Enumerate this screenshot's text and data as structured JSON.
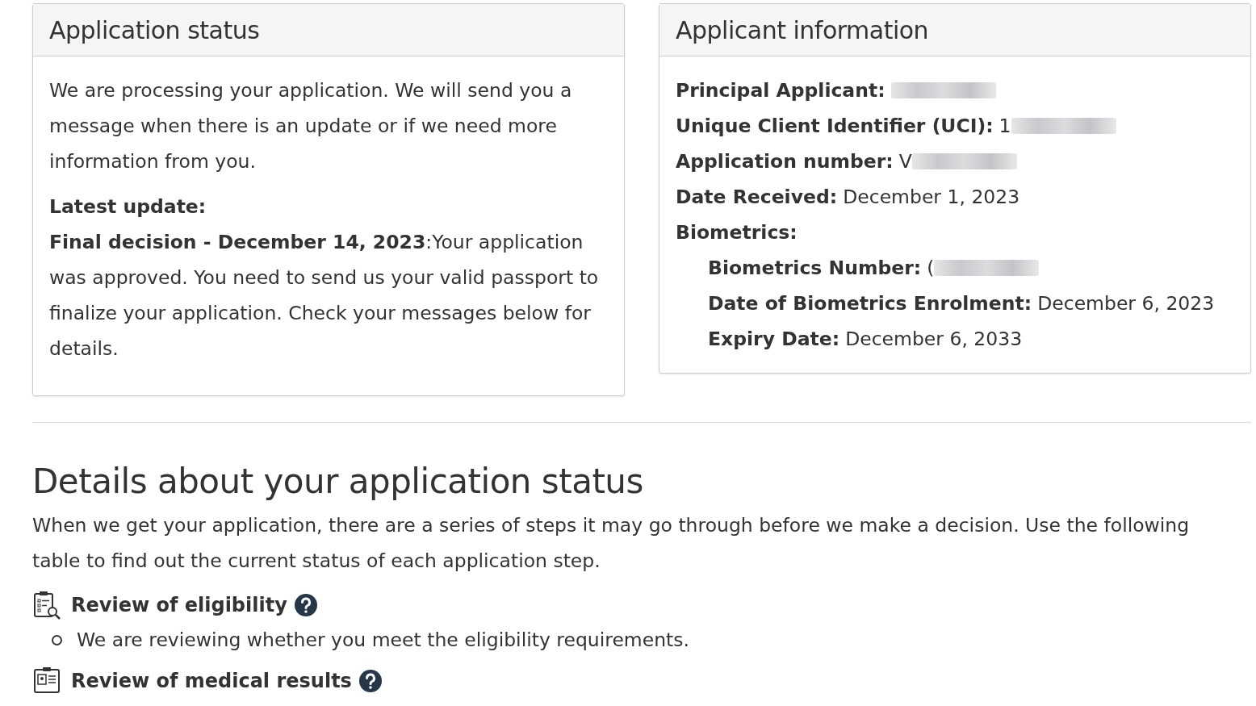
{
  "status_card": {
    "title": "Application status",
    "message": "We are processing your application. We will send you a message when there is an update or if we need more information from you.",
    "latest_label": "Latest update:",
    "latest_text": "**Final decision - December 14, 2023**:Your application was approved. You need to send us your valid passport to finalize your application. Check your messages below for details."
  },
  "applicant_card": {
    "title": "Applicant information",
    "fields": [
      {
        "label": "Principal Applicant:",
        "redacted": true
      },
      {
        "label": "Unique Client Identifier (UCI):",
        "value": "1",
        "redacted": true
      },
      {
        "label": "Application number:",
        "value": "V",
        "redacted": true
      },
      {
        "label": "Date Received:",
        "value": "December 1, 2023"
      },
      {
        "label": "Biometrics:",
        "children": [
          {
            "label": "Biometrics Number:",
            "value": "(",
            "redacted": true
          },
          {
            "label": "Date of Biometrics Enrolment:",
            "value": "December 6, 2023"
          },
          {
            "label": "Expiry Date:",
            "value": "December 6, 2033"
          }
        ]
      }
    ]
  },
  "details": {
    "heading": "Details about your application status",
    "intro": "When we get your application, there are a series of steps it may go through before we make a decision. Use the following table to find out the current status of each application step.",
    "steps": [
      {
        "kind": "eligibility",
        "title": "Review of eligibility",
        "bullets": [
          "We are reviewing whether you meet the eligibility requirements."
        ]
      },
      {
        "kind": "medical",
        "title": "Review of medical results"
      }
    ]
  }
}
